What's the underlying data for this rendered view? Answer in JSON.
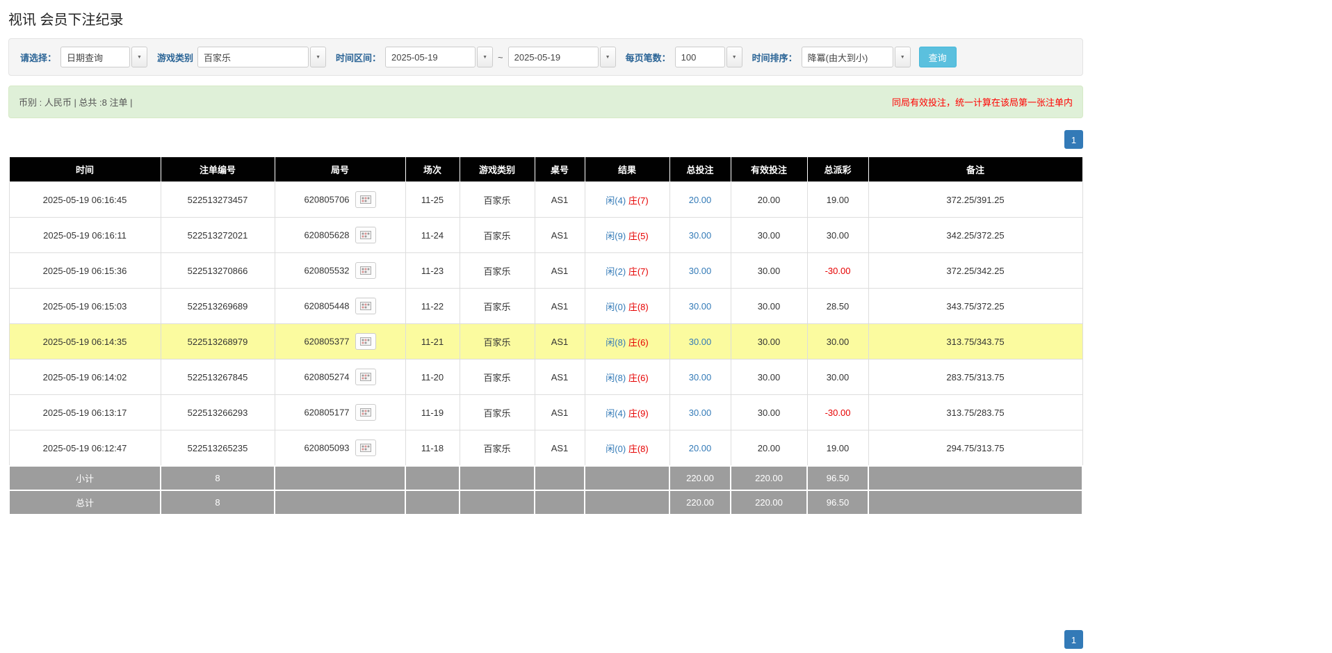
{
  "colors": {
    "accent_blue": "#337ab7",
    "label_blue": "#2a6496",
    "search_button_bg": "#5bc0de",
    "header_bg": "#010101",
    "highlight_row_bg": "#fbfb9f",
    "summary_row_bg": "#9d9d9d",
    "negative_red": "#e60000",
    "notice_red": "#ff0000",
    "info_bar_bg": "#dff0d8"
  },
  "page": {
    "title": "视讯 会员下注纪录"
  },
  "filters": {
    "select_label": "请选择：",
    "select_value": "日期查询",
    "game_type_label": "游戏类别",
    "game_type_value": "百家乐",
    "time_range_label": "时间区间：",
    "time_from": "2025-05-19",
    "range_separator": "~",
    "time_to": "2025-05-19",
    "page_size_label": "每页笔数：",
    "page_size_value": "100",
    "sort_label": "时间排序：",
    "sort_value": "降冪(由大到小)",
    "search_button": "查询"
  },
  "info_bar": {
    "summary": "币别 : 人民币 | 总共 :8 注单 |",
    "notice": "同局有效投注，统一计算在该局第一张注单内"
  },
  "pagination": {
    "page": "1"
  },
  "table": {
    "headers": [
      "时间",
      "注单编号",
      "局号",
      "场次",
      "游戏类别",
      "桌号",
      "结果",
      "总投注",
      "有效投注",
      "总派彩",
      "备注"
    ],
    "rows": [
      {
        "time": "2025-05-19 06:16:45",
        "bet_id": "522513273457",
        "round_id": "620805706",
        "session": "11-25",
        "game_type": "百家乐",
        "table_no": "AS1",
        "result_player": "闲(4)",
        "result_banker": "庄(7)",
        "total_bet": "20.00",
        "valid_bet": "20.00",
        "payout": "19.00",
        "remark": "372.25/391.25",
        "highlighted": false
      },
      {
        "time": "2025-05-19 06:16:11",
        "bet_id": "522513272021",
        "round_id": "620805628",
        "session": "11-24",
        "game_type": "百家乐",
        "table_no": "AS1",
        "result_player": "闲(9)",
        "result_banker": "庄(5)",
        "total_bet": "30.00",
        "valid_bet": "30.00",
        "payout": "30.00",
        "remark": "342.25/372.25",
        "highlighted": false
      },
      {
        "time": "2025-05-19 06:15:36",
        "bet_id": "522513270866",
        "round_id": "620805532",
        "session": "11-23",
        "game_type": "百家乐",
        "table_no": "AS1",
        "result_player": "闲(2)",
        "result_banker": "庄(7)",
        "total_bet": "30.00",
        "valid_bet": "30.00",
        "payout": "-30.00",
        "remark": "372.25/342.25",
        "highlighted": false
      },
      {
        "time": "2025-05-19 06:15:03",
        "bet_id": "522513269689",
        "round_id": "620805448",
        "session": "11-22",
        "game_type": "百家乐",
        "table_no": "AS1",
        "result_player": "闲(0)",
        "result_banker": "庄(8)",
        "total_bet": "30.00",
        "valid_bet": "30.00",
        "payout": "28.50",
        "remark": "343.75/372.25",
        "highlighted": false
      },
      {
        "time": "2025-05-19 06:14:35",
        "bet_id": "522513268979",
        "round_id": "620805377",
        "session": "11-21",
        "game_type": "百家乐",
        "table_no": "AS1",
        "result_player": "闲(8)",
        "result_banker": "庄(6)",
        "total_bet": "30.00",
        "valid_bet": "30.00",
        "payout": "30.00",
        "remark": "313.75/343.75",
        "highlighted": true
      },
      {
        "time": "2025-05-19 06:14:02",
        "bet_id": "522513267845",
        "round_id": "620805274",
        "session": "11-20",
        "game_type": "百家乐",
        "table_no": "AS1",
        "result_player": "闲(8)",
        "result_banker": "庄(6)",
        "total_bet": "30.00",
        "valid_bet": "30.00",
        "payout": "30.00",
        "remark": "283.75/313.75",
        "highlighted": false
      },
      {
        "time": "2025-05-19 06:13:17",
        "bet_id": "522513266293",
        "round_id": "620805177",
        "session": "11-19",
        "game_type": "百家乐",
        "table_no": "AS1",
        "result_player": "闲(4)",
        "result_banker": "庄(9)",
        "total_bet": "30.00",
        "valid_bet": "30.00",
        "payout": "-30.00",
        "remark": "313.75/283.75",
        "highlighted": false
      },
      {
        "time": "2025-05-19 06:12:47",
        "bet_id": "522513265235",
        "round_id": "620805093",
        "session": "11-18",
        "game_type": "百家乐",
        "table_no": "AS1",
        "result_player": "闲(0)",
        "result_banker": "庄(8)",
        "total_bet": "20.00",
        "valid_bet": "20.00",
        "payout": "19.00",
        "remark": "294.75/313.75",
        "highlighted": false
      }
    ],
    "subtotal": {
      "label": "小计",
      "count": "8",
      "total_bet": "220.00",
      "valid_bet": "220.00",
      "payout": "96.50"
    },
    "total": {
      "label": "总计",
      "count": "8",
      "total_bet": "220.00",
      "valid_bet": "220.00",
      "payout": "96.50"
    }
  }
}
